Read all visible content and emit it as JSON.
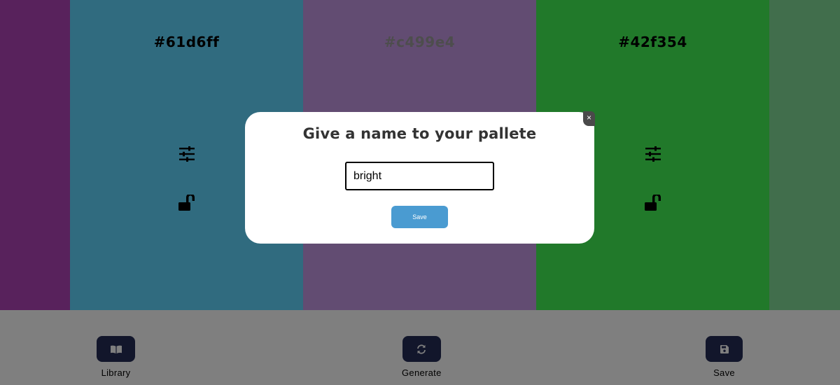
{
  "palette": {
    "columns": [
      {
        "hex": "",
        "bg": "#b044b8"
      },
      {
        "hex": "#61d6ff",
        "bg": "#61d6ff",
        "text_color": "#000000"
      },
      {
        "hex": "#c499e4",
        "bg": "#c499e4",
        "text_color": "#9a9a9a"
      },
      {
        "hex": "#42f354",
        "bg": "#42f354",
        "text_color": "#000000"
      },
      {
        "hex": "",
        "bg": "#83dc99"
      }
    ],
    "icons": {
      "adjust": "sliders-icon",
      "lock": "unlock-icon"
    }
  },
  "modal": {
    "title": "Give a name to your pallete",
    "input_value": "bright",
    "save_label": "Save",
    "close_label": "×"
  },
  "panel": {
    "library_label": "Library",
    "generate_label": "Generate",
    "save_label": "Save",
    "button_color": "#252d57"
  }
}
